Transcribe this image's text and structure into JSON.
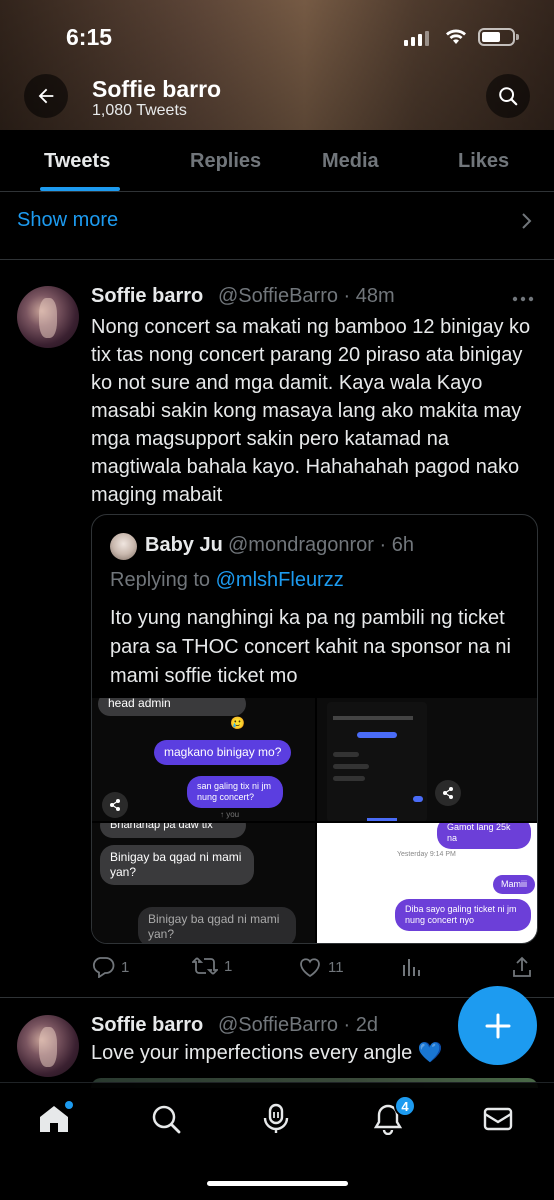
{
  "status_bar": {
    "time": "6:15"
  },
  "profile": {
    "name": "Soffie barro",
    "tweet_count": "1,080 Tweets"
  },
  "tabs": [
    {
      "label": "Tweets",
      "active": true
    },
    {
      "label": "Replies",
      "active": false
    },
    {
      "label": "Media",
      "active": false
    },
    {
      "label": "Likes",
      "active": false
    }
  ],
  "show_more": "Show more",
  "tweets": [
    {
      "name": "Soffie barro",
      "handle": "@SoffieBarro · 48m",
      "text": "Nong concert sa makati ng bamboo 12 binigay ko tix tas nong concert parang 20 piraso ata binigay ko not sure and mga damit. Kaya wala Kayo masabi sakin kong masaya lang ako makita may mga magsupport sakin pero katamad na magtiwala bahala kayo. Hahahahah pagod nako maging mabait",
      "quote": {
        "name": "Baby Ju",
        "handle": "@mondragonror · 6h",
        "replying_to_label": "Replying to",
        "replying_to_handle": "@mlshFleurzz",
        "text": "Ito yung nanghingi ka pa ng pambili ng ticket para sa THOC concert kahit na sponsor na ni mami soffie ticket mo",
        "media": {
          "top_left": {
            "bubble1": "head admin",
            "bubble2": "magkano binigay mo?",
            "bubble3": "san galing tix ni jm nung concert?",
            "you_label": "↑ you"
          },
          "bottom_left": {
            "bubble1": "Bnahanap pa daw tix",
            "bubble2": "Binigay ba qgad ni mami yan?",
            "bubble3": "Binigay ba qgad ni mami yan?"
          },
          "bottom_right": {
            "bubble1": "Gamot lang 25k na",
            "timestamp": "Yesterday 9:14 PM",
            "bubble2": "Mamiii",
            "bubble3": "Diba sayo galing ticket ni jm nung concert nyo"
          }
        }
      },
      "stats": {
        "replies": "1",
        "retweets": "1",
        "likes": "11"
      }
    },
    {
      "name": "Soffie barro",
      "handle": "@SoffieBarro · 2d",
      "text": "Love your imperfections every angle 💙"
    }
  ],
  "bottom_nav": {
    "notification_count": "4"
  },
  "colors": {
    "accent": "#1d9bf0",
    "background": "#000000",
    "muted": "#71767b"
  }
}
